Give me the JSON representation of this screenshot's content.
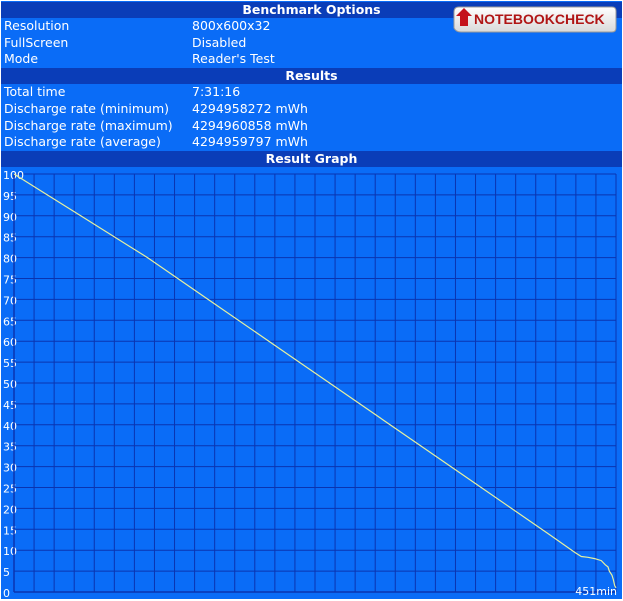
{
  "benchmark_options": {
    "title": "Benchmark Options",
    "rows": [
      {
        "label": "Resolution",
        "value": "800x600x32"
      },
      {
        "label": "FullScreen",
        "value": "Disabled"
      },
      {
        "label": "Mode",
        "value": "Reader's Test"
      }
    ]
  },
  "results": {
    "title": "Results",
    "rows": [
      {
        "label": "Total time",
        "value": "7:31:16"
      },
      {
        "label": "Discharge rate (minimum)",
        "value": "4294958272 mWh"
      },
      {
        "label": "Discharge rate (maximum)",
        "value": "4294960858 mWh"
      },
      {
        "label": "Discharge rate (average)",
        "value": "4294959797 mWh"
      }
    ]
  },
  "result_graph": {
    "title": "Result Graph"
  },
  "logo": {
    "text": "NOTEBOOKCHECK"
  },
  "colors": {
    "background": "#0a6cf7",
    "header": "#0a3db8",
    "grid": "#0a34b0",
    "line": "#e6f0a0"
  },
  "chart_data": {
    "type": "line",
    "title": "Result Graph",
    "xlabel": "",
    "ylabel": "",
    "x_end_label": "451min",
    "ylim": [
      0,
      100
    ],
    "xlim": [
      0,
      451
    ],
    "yticks": [
      100,
      95,
      90,
      85,
      80,
      75,
      70,
      65,
      60,
      55,
      50,
      45,
      40,
      35,
      30,
      25,
      20,
      15,
      10,
      5,
      0
    ],
    "grid": true,
    "series": [
      {
        "points": [
          [
            0,
            100
          ],
          [
            20,
            96
          ],
          [
            50,
            90
          ],
          [
            100,
            80
          ],
          [
            150,
            69
          ],
          [
            200,
            58
          ],
          [
            250,
            47
          ],
          [
            300,
            36
          ],
          [
            350,
            25
          ],
          [
            400,
            14
          ],
          [
            420,
            9.5
          ],
          [
            425,
            8.5
          ],
          [
            430,
            8.3
          ],
          [
            435,
            8.0
          ],
          [
            440,
            7.5
          ],
          [
            443,
            6.5
          ],
          [
            445,
            6.0
          ],
          [
            446,
            5.0
          ],
          [
            448,
            4.0
          ],
          [
            449,
            3.0
          ],
          [
            450,
            1.5
          ],
          [
            451,
            1.0
          ]
        ]
      }
    ]
  }
}
